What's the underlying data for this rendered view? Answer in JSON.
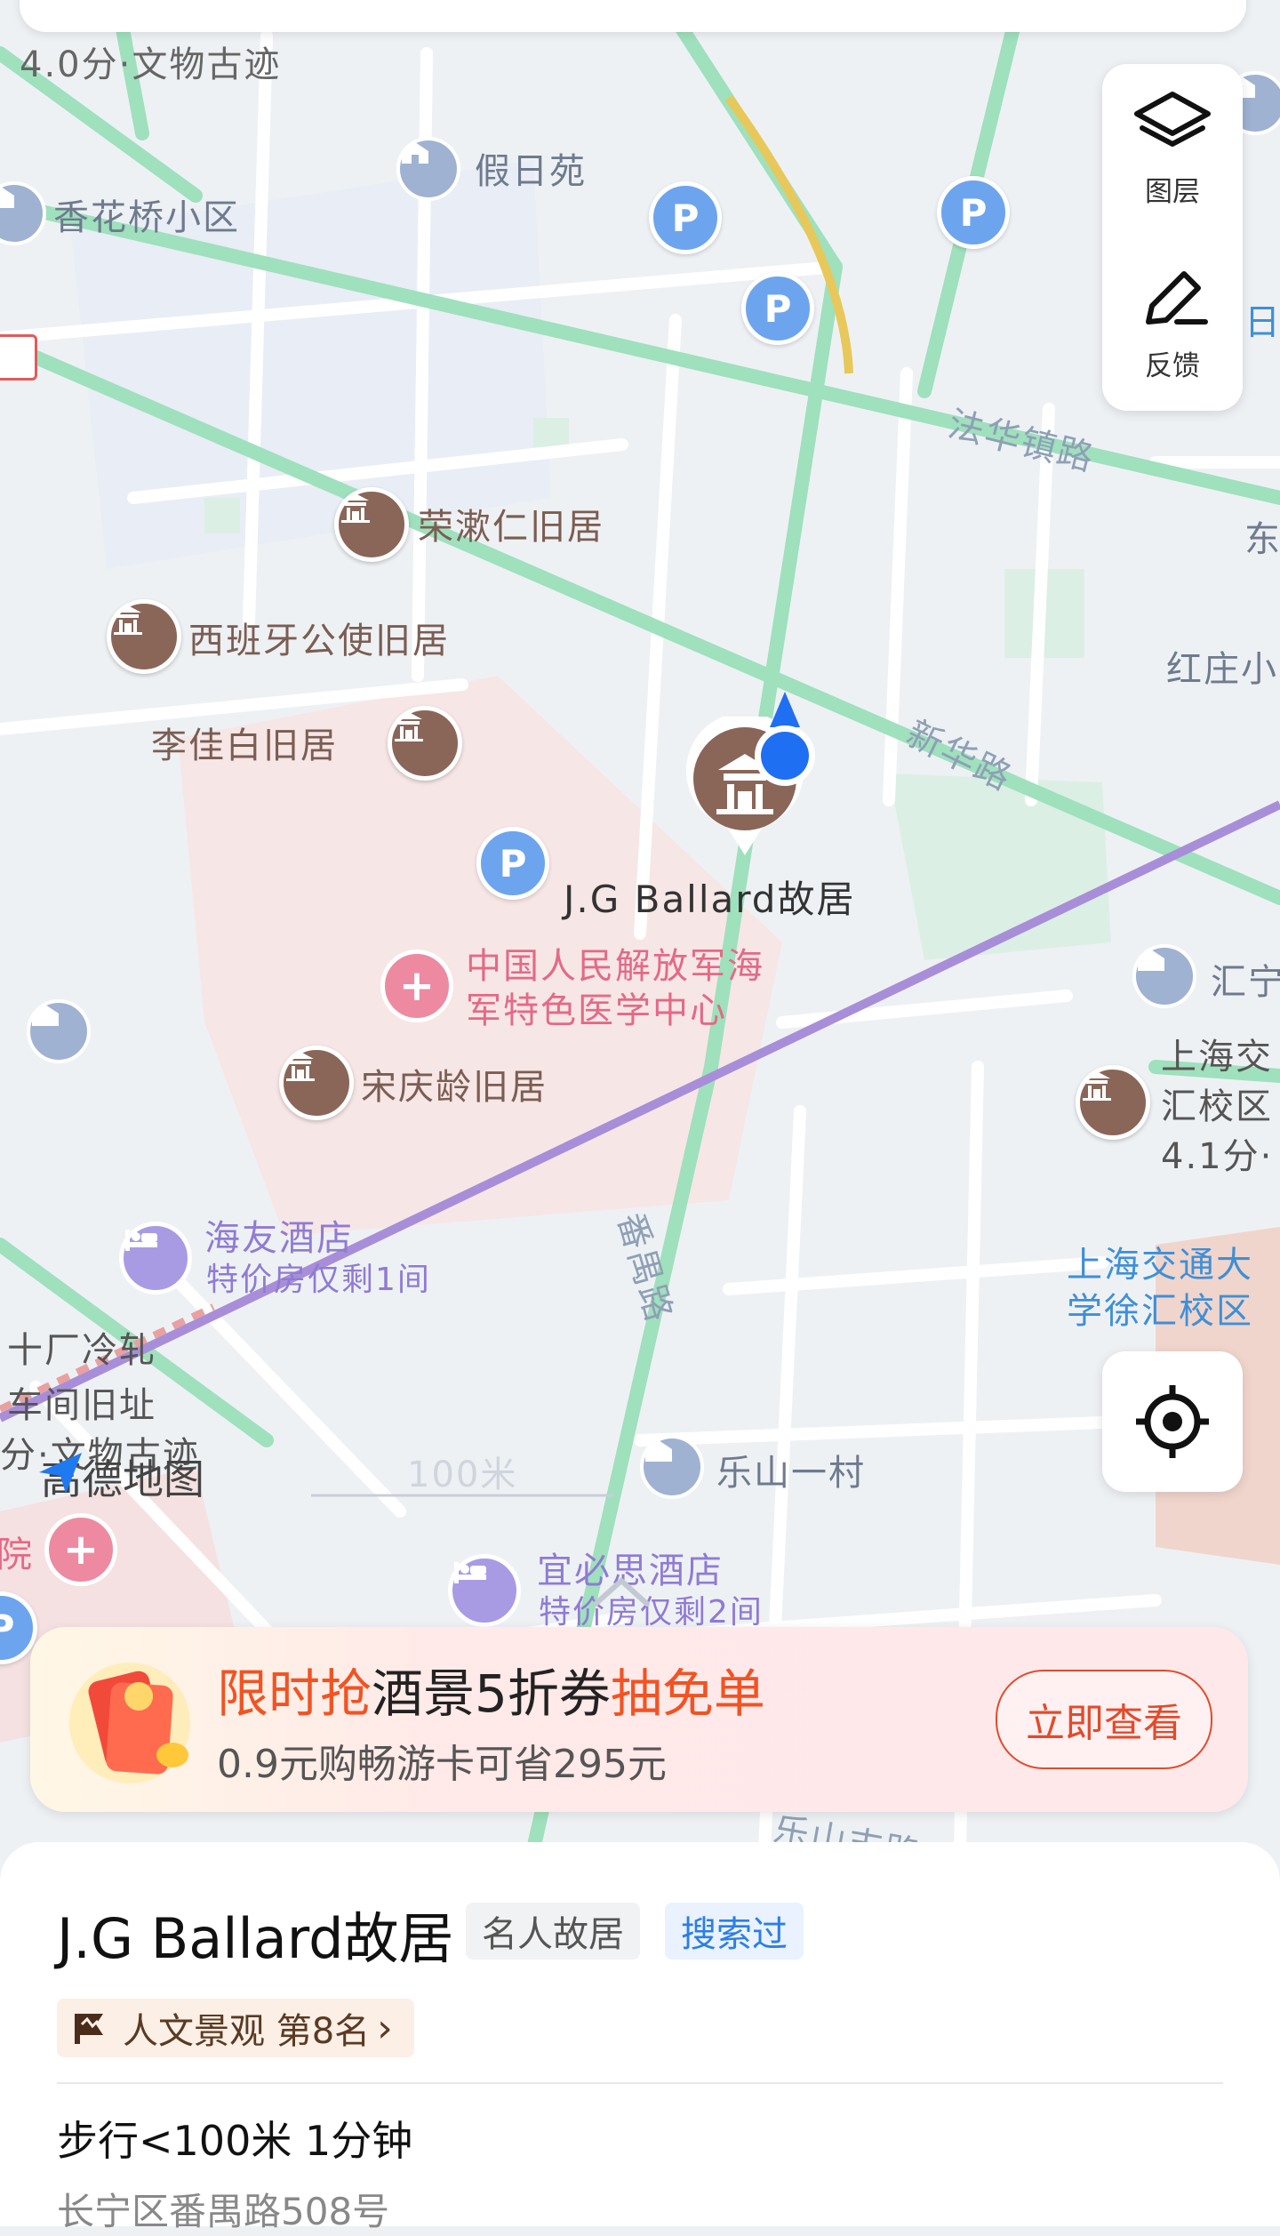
{
  "map": {
    "labels": {
      "top_left_rating": "4.0分·文物古迹",
      "jiariyuan": "假日苑",
      "xianghuaqiao": "香花桥小区",
      "fahuazhen_road": "法华镇路",
      "rongshiren": "荣漱仁旧居",
      "spain_consul": "西班牙公使旧居",
      "li_jiabai": "李佳白旧居",
      "jg_ballard": "J.G Ballard故居",
      "xinhua_road": "新华路",
      "hongzhuang": "红庄小",
      "dong": "东",
      "ri": "日",
      "hospital_1": "中国人民解放军海",
      "hospital_2": "军特色医学中心",
      "soong_qingling": "宋庆龄旧居",
      "huining": "汇宁",
      "sjtu_xuhui_1": "上海交",
      "sjtu_xuhui_2": "汇校区",
      "sjtu_xuhui_3": "4.1分·",
      "haiyou_hotel": "海友酒店",
      "haiyou_deal": "特价房仅剩1间",
      "fanyu_road": "番禺路",
      "sjtu_campus_1": "上海交通大",
      "sjtu_campus_2": "学徐汇校区",
      "factory_1": "十厂冷轧",
      "factory_2": "车间旧址",
      "factory_3": "分·文物古迹",
      "amap_logo": "高德地图",
      "scale": "100米",
      "leshan": "乐山一村",
      "yuan": "院",
      "yibisi_hotel": "宜必思酒店",
      "yibisi_deal": "特价房仅剩2间",
      "bottom_road": "乐山支路"
    },
    "parking_glyph": "P",
    "hospital_glyph": "+"
  },
  "controls": {
    "layers_label": "图层",
    "feedback_label": "反馈"
  },
  "promo": {
    "title_red_1": "限时抢",
    "title_black": "酒景5折券",
    "title_red_2": "抽免单",
    "subtitle": "0.9元购畅游卡可省295元",
    "button": "立即查看"
  },
  "poi": {
    "name": "J.G Ballard故居",
    "category_tag": "名人故居",
    "history_tag": "搜索过",
    "rank_text": "人文景观 第8名",
    "rank_chevron": "›",
    "walk_info": "步行<100米 1分钟",
    "address": "长宁区番禺路508号"
  },
  "colors": {
    "road_green": "#9fe0bd",
    "metro_purple": "#a88ed8",
    "brown_pin": "#8a6658",
    "promo_red": "#f25322",
    "location_blue": "#1f6ff2"
  }
}
